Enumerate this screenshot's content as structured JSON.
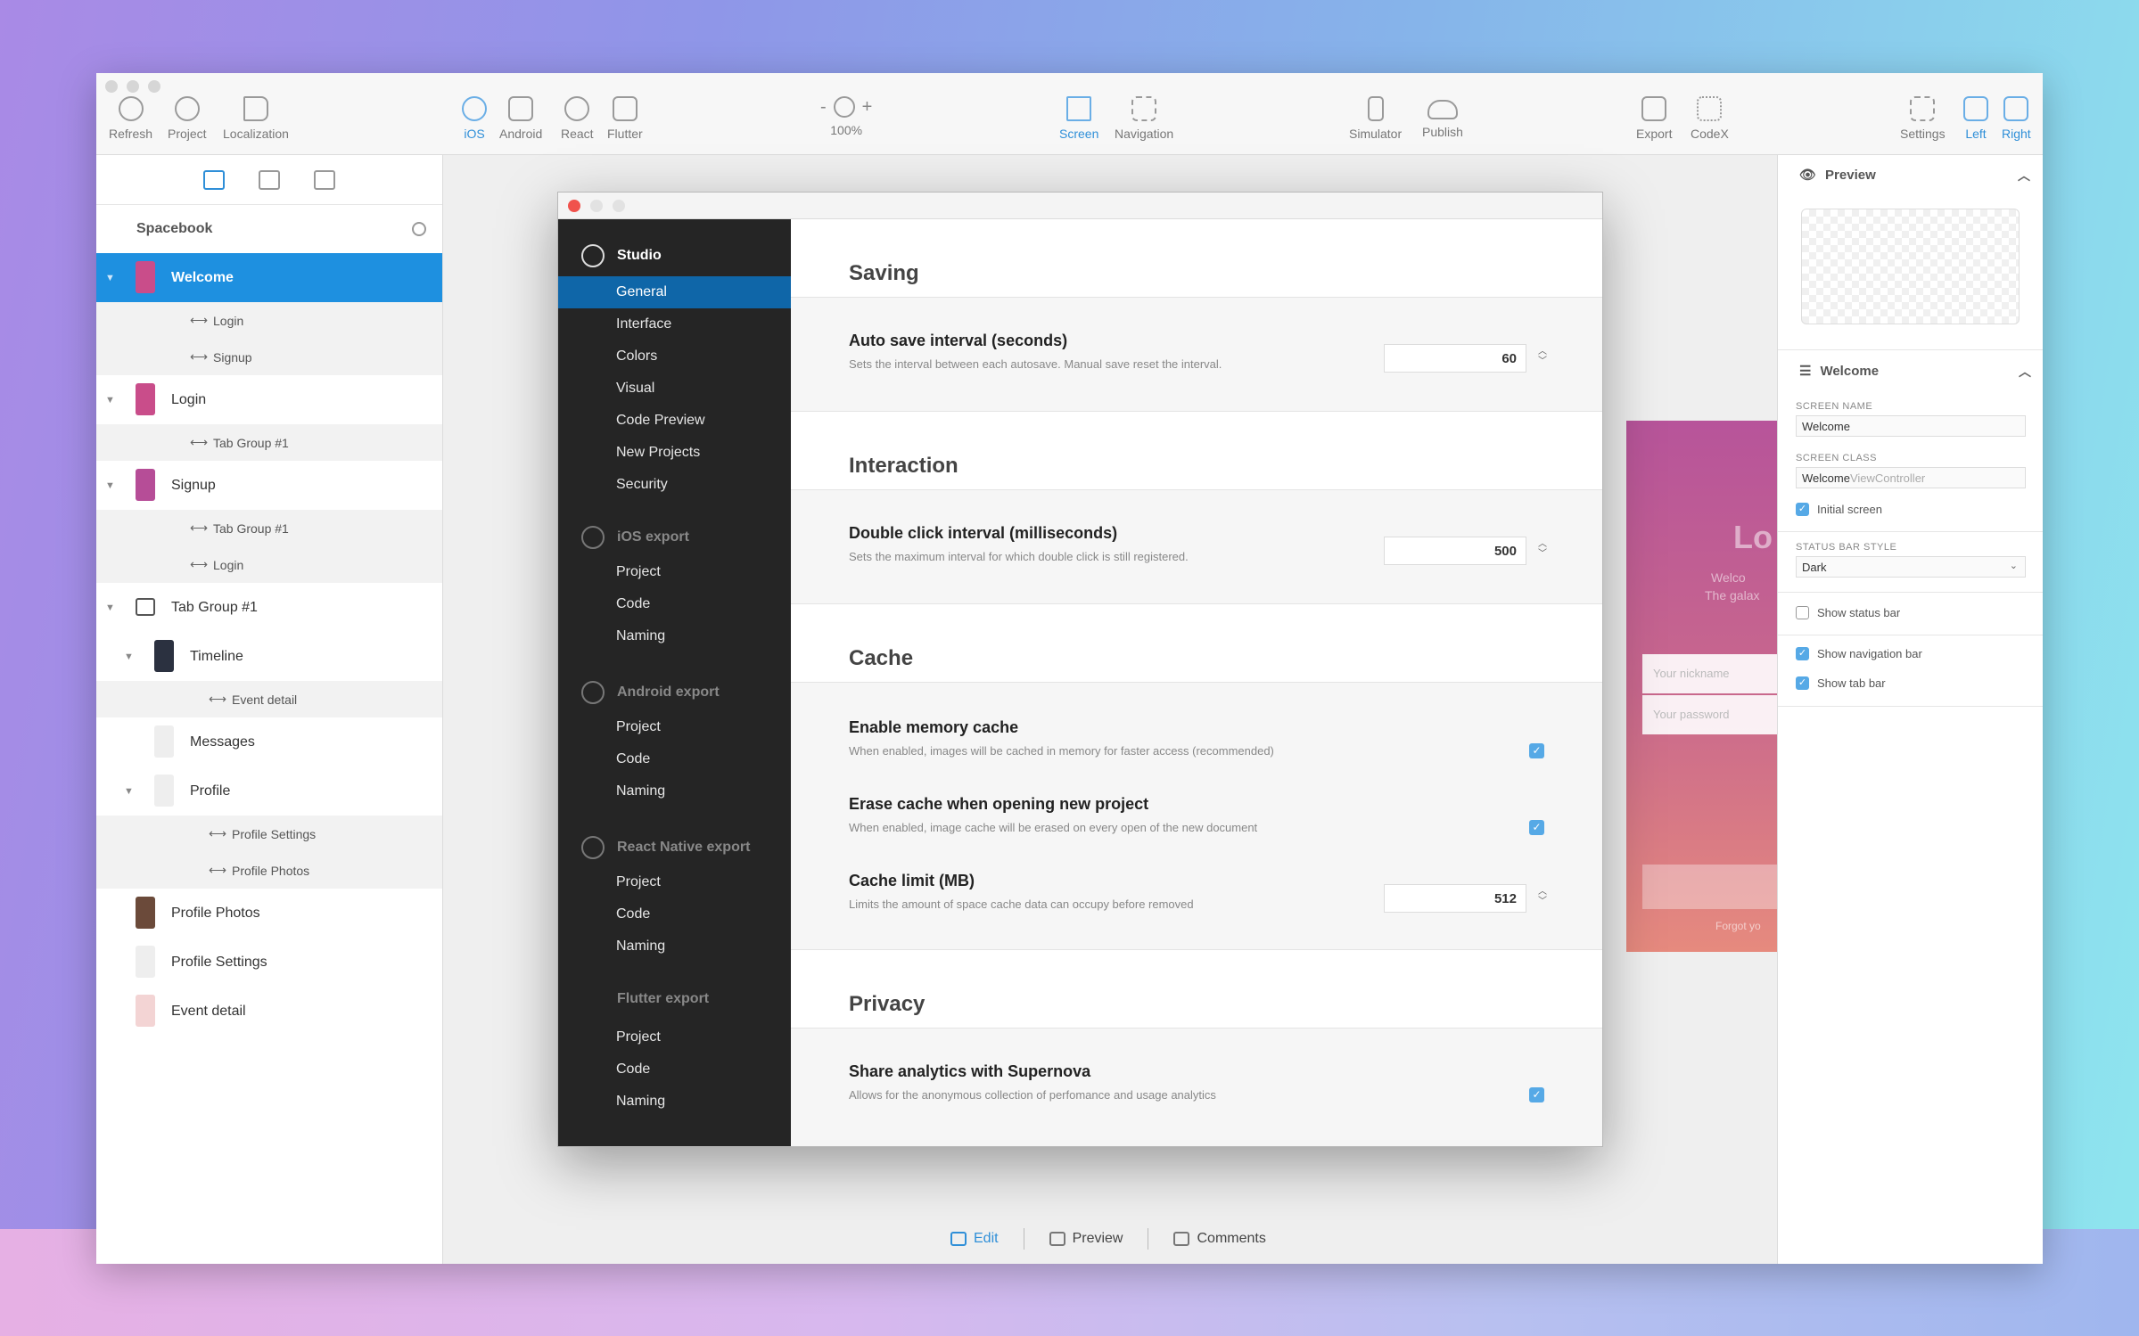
{
  "toolbar": {
    "left": [
      {
        "label": "Refresh",
        "icon": "refresh-icon"
      },
      {
        "label": "Project",
        "icon": "gear-icon"
      },
      {
        "label": "Localization",
        "icon": "flag-icon"
      }
    ],
    "platforms": [
      {
        "label": "iOS",
        "icon": "apple-icon",
        "active": true
      },
      {
        "label": "Android",
        "icon": "android-icon"
      },
      {
        "label": "React",
        "icon": "react-icon"
      },
      {
        "label": "Flutter",
        "icon": "flutter-icon"
      }
    ],
    "zoom": {
      "minus": "-",
      "plus": "+",
      "value": "100%"
    },
    "views": [
      {
        "label": "Screen",
        "icon": "screen-icon",
        "active": true
      },
      {
        "label": "Navigation",
        "icon": "grid-icon"
      }
    ],
    "actions": [
      {
        "label": "Simulator",
        "icon": "phone-icon"
      },
      {
        "label": "Publish",
        "icon": "cloud-upload-icon"
      }
    ],
    "export": [
      {
        "label": "Export",
        "icon": "export-icon"
      },
      {
        "label": "CodeX",
        "icon": "code-icon"
      }
    ],
    "panels": [
      {
        "label": "Settings",
        "icon": "sliders-icon"
      },
      {
        "label": "Left",
        "icon": "left-panel-icon",
        "active": true
      },
      {
        "label": "Right",
        "icon": "right-panel-icon",
        "active": true
      }
    ]
  },
  "sidebar": {
    "project_name": "Spacebook",
    "tree": [
      {
        "kind": "main",
        "label": "Welcome",
        "selected": true,
        "arrow": true,
        "level": 0,
        "thumb": "#c94d8a"
      },
      {
        "kind": "sub",
        "label": "Login",
        "level": 1
      },
      {
        "kind": "sub",
        "label": "Signup",
        "level": 1
      },
      {
        "kind": "main",
        "label": "Login",
        "arrow": true,
        "level": 0,
        "thumb": "#c94d8a"
      },
      {
        "kind": "sub",
        "label": "Tab Group #1",
        "level": 1
      },
      {
        "kind": "main",
        "label": "Signup",
        "arrow": true,
        "level": 0,
        "thumb": "#b64d97"
      },
      {
        "kind": "sub",
        "label": "Tab Group #1",
        "level": 1
      },
      {
        "kind": "sub",
        "label": "Login",
        "level": 1
      },
      {
        "kind": "main",
        "label": "Tab Group #1",
        "arrow": true,
        "level": 0,
        "thumb": "tab"
      },
      {
        "kind": "main",
        "label": "Timeline",
        "arrow": true,
        "level": 1,
        "thumb": "#2b3140"
      },
      {
        "kind": "sub",
        "label": "Event detail",
        "level": 2
      },
      {
        "kind": "main",
        "label": "Messages",
        "level": 1,
        "thumb": "#eeeeee"
      },
      {
        "kind": "main",
        "label": "Profile",
        "arrow": true,
        "level": 1,
        "thumb": "#eeeeee"
      },
      {
        "kind": "sub",
        "label": "Profile Settings",
        "level": 2
      },
      {
        "kind": "sub",
        "label": "Profile Photos",
        "level": 2
      },
      {
        "kind": "main",
        "label": "Profile Photos",
        "level": 0,
        "thumb": "#6b4a3a"
      },
      {
        "kind": "main",
        "label": "Profile Settings",
        "level": 0,
        "thumb": "#eeeeee"
      },
      {
        "kind": "main",
        "label": "Event detail",
        "level": 0,
        "thumb": "#f3d4d4"
      }
    ]
  },
  "dialog": {
    "nav": {
      "studio": {
        "title": "Studio",
        "items": [
          "General",
          "Interface",
          "Colors",
          "Visual",
          "Code Preview",
          "New Projects",
          "Security"
        ],
        "active": "General"
      },
      "ios": {
        "title": "iOS export",
        "items": [
          "Project",
          "Code",
          "Naming"
        ]
      },
      "android": {
        "title": "Android export",
        "items": [
          "Project",
          "Code",
          "Naming"
        ]
      },
      "react": {
        "title": "React Native export",
        "items": [
          "Project",
          "Code",
          "Naming"
        ]
      },
      "flutter": {
        "title": "Flutter export",
        "items": [
          "Project",
          "Code",
          "Naming"
        ]
      }
    },
    "sections": {
      "saving": {
        "title": "Saving",
        "auto_save": {
          "title": "Auto save interval (seconds)",
          "desc": "Sets the interval between each autosave. Manual save reset the interval.",
          "value": "60"
        }
      },
      "interaction": {
        "title": "Interaction",
        "double_click": {
          "title": "Double click interval (milliseconds)",
          "desc": "Sets the maximum interval for which double click is still registered.",
          "value": "500"
        }
      },
      "cache": {
        "title": "Cache",
        "memory": {
          "title": "Enable memory cache",
          "desc": "When enabled, images will be cached in memory for faster access (recommended)",
          "checked": true
        },
        "erase": {
          "title": "Erase cache when opening new project",
          "desc": "When enabled, image cache will be erased on every open of the new document",
          "checked": true
        },
        "limit": {
          "title": "Cache limit (MB)",
          "desc": "Limits the amount of space cache data can occupy before removed",
          "value": "512"
        }
      },
      "privacy": {
        "title": "Privacy",
        "analytics": {
          "title": "Share analytics with Supernova",
          "desc": "Allows for the anonymous collection of perfomance and usage analytics",
          "checked": true
        }
      }
    }
  },
  "canvas_preview": {
    "heading": "Lo",
    "line1": "Welco",
    "line2": "The galax",
    "nickname_placeholder": "Your nickname",
    "password_placeholder": "Your password",
    "forgot": "Forgot yo"
  },
  "right_panel": {
    "preview_title": "Preview",
    "screen_title": "Welcome",
    "screen_name_label": "SCREEN NAME",
    "screen_name_value": "Welcome",
    "screen_class_label": "SCREEN CLASS",
    "screen_class_value": "Welcome",
    "screen_class_suffix": "ViewController",
    "initial_screen": "Initial screen",
    "status_bar_style_label": "STATUS BAR STYLE",
    "status_bar_style_value": "Dark",
    "show_status_bar": "Show status bar",
    "show_navigation_bar": "Show navigation bar",
    "show_tab_bar": "Show tab bar"
  },
  "bottom_bar": {
    "edit": "Edit",
    "preview": "Preview",
    "comments": "Comments"
  },
  "colors": {
    "accent": "#1e90e0",
    "dialog_sidebar": "#252525",
    "dialog_active": "#0f66a8",
    "checkbox": "#56a9e6"
  }
}
